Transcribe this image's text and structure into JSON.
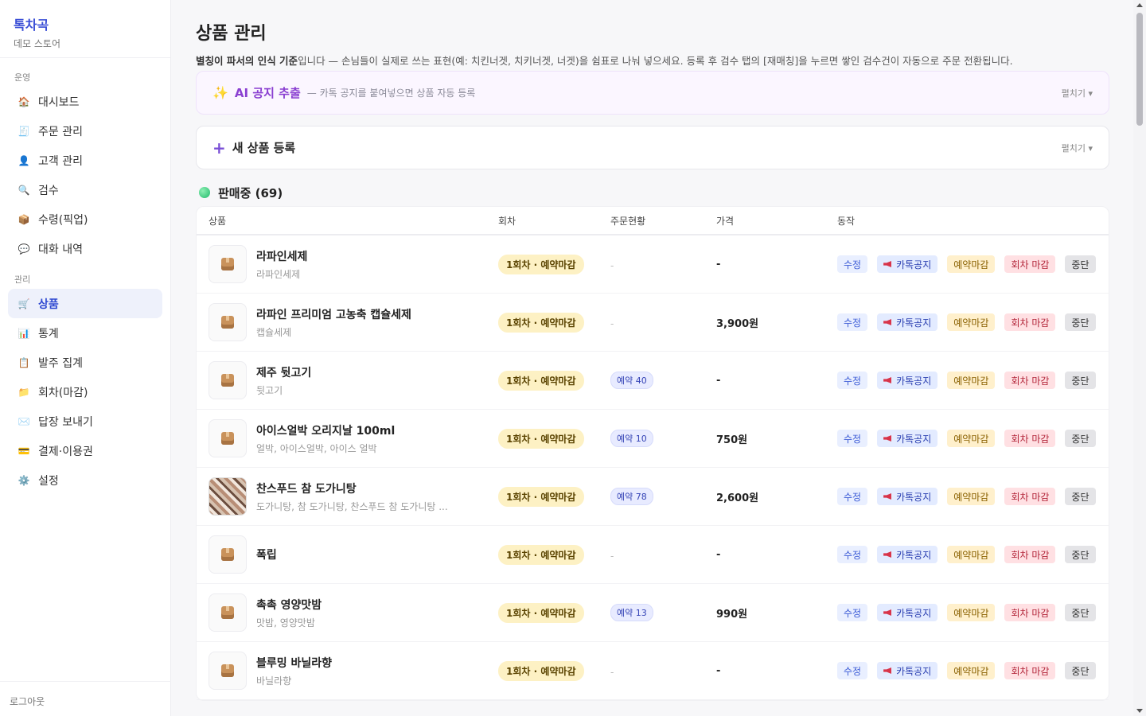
{
  "sidebar": {
    "brand": "톡차곡",
    "store": "데모 스토어",
    "section_ops": "운영",
    "ops_items": [
      {
        "label": "대시보드",
        "icon": "🏠"
      },
      {
        "label": "주문 관리",
        "icon": "🧾"
      },
      {
        "label": "고객 관리",
        "icon": "👤"
      },
      {
        "label": "검수",
        "icon": "🔍"
      },
      {
        "label": "수령(픽업)",
        "icon": "📦"
      },
      {
        "label": "대화 내역",
        "icon": "💬"
      }
    ],
    "section_manage": "관리",
    "manage_items": [
      {
        "label": "상품",
        "icon": "🛒"
      },
      {
        "label": "통계",
        "icon": "📊"
      },
      {
        "label": "발주 집계",
        "icon": "📋"
      },
      {
        "label": "회차(마감)",
        "icon": "📁"
      },
      {
        "label": "답장 보내기",
        "icon": "✉️"
      },
      {
        "label": "결제·이용권",
        "icon": "💳"
      },
      {
        "label": "설정",
        "icon": "⚙️"
      }
    ],
    "logout": "로그아웃"
  },
  "main": {
    "title": "상품 관리",
    "desc_bold": "별칭이 파서의 인식 기준",
    "desc_rest": "입니다 — 손님들이 실제로 쓰는 표현(예: 치킨너겟, 치키너겟, 너겟)을 쉼표로 나눠 넣으세요. 등록 후 검수 탭의 [재매칭]을 누르면 쌓인 검수건이 자동으로 주문 전환됩니다.",
    "ai_panel": {
      "icon": "✨",
      "title": "AI 공지 추출",
      "sub": "— 카톡 공지를 붙여넣으면 상품 자동 등록",
      "toggle": "펼치기 ▾"
    },
    "new_panel": {
      "title": "새 상품 등록",
      "toggle": "펼치기 ▾"
    },
    "section_title": "판매중 (69)",
    "columns": {
      "product": "상품",
      "round": "회차",
      "orders": "주문현황",
      "price": "가격",
      "actions": "동작"
    },
    "action_labels": {
      "edit": "수정",
      "kakao": "카톡공지",
      "reserve": "예약마감",
      "round_close": "회차 마감",
      "stop": "중단"
    },
    "rows": [
      {
        "name": "라파인세제",
        "alias": "라파인세제",
        "round": "1회차 · 예약마감",
        "orders": "-",
        "price": "-"
      },
      {
        "name": "라파인 프리미엄 고농축 캡슐세제",
        "alias": "캡슐세제",
        "round": "1회차 · 예약마감",
        "orders": "-",
        "price": "3,900원"
      },
      {
        "name": "제주 뒷고기",
        "alias": "뒷고기",
        "round": "1회차 · 예약마감",
        "orders": "예약 40",
        "price": "-"
      },
      {
        "name": "아이스얼박 오리지날 100ml",
        "alias": "얼박, 아이스얼박, 아이스 얼박",
        "round": "1회차 · 예약마감",
        "orders": "예약 10",
        "price": "750원"
      },
      {
        "name": "찬스푸드 참 도가니탕",
        "alias": "도가니탕, 참 도가니탕, 찬스푸드 참 도가니탕 ...",
        "round": "1회차 · 예약마감",
        "orders": "예약 78",
        "price": "2,600원"
      },
      {
        "name": "폭립",
        "alias": "",
        "round": "1회차 · 예약마감",
        "orders": "-",
        "price": "-"
      },
      {
        "name": "촉촉 영양맛밤",
        "alias": "맛밤, 영양맛밤",
        "round": "1회차 · 예약마감",
        "orders": "예약 13",
        "price": "990원"
      },
      {
        "name": "블루밍 바닐라향",
        "alias": "바닐라향",
        "round": "1회차 · 예약마감",
        "orders": "-",
        "price": "-"
      }
    ]
  }
}
